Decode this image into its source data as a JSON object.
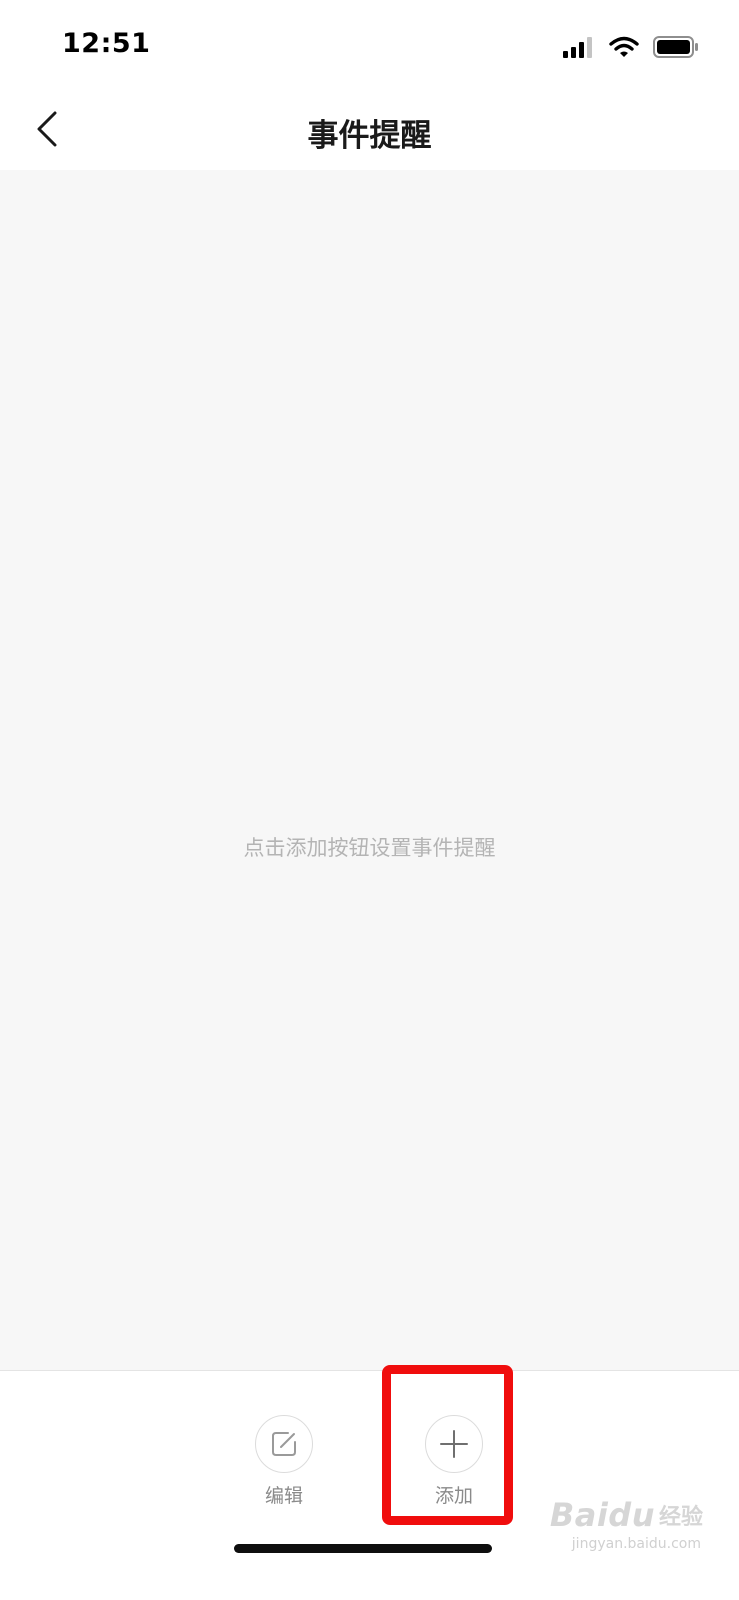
{
  "status_bar": {
    "time": "12:51",
    "icons": [
      "cellular-signal-icon",
      "wifi-icon",
      "battery-icon"
    ]
  },
  "nav": {
    "back_icon": "chevron-left-icon",
    "title": "事件提醒"
  },
  "content": {
    "empty_hint": "点击添加按钮设置事件提醒"
  },
  "toolbar": {
    "edit": {
      "icon": "edit-icon",
      "label": "编辑"
    },
    "add": {
      "icon": "plus-icon",
      "label": "添加"
    }
  },
  "watermark": {
    "brand": "Baidu",
    "brand_cn": "经验",
    "url": "jingyan.baidu.com"
  },
  "colors": {
    "highlight": "#f00d0d",
    "content_bg": "#f7f7f7",
    "hint_text": "#b4b4b4"
  }
}
